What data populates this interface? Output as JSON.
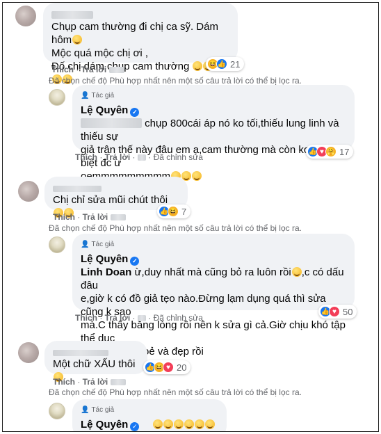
{
  "comments": [
    {
      "text_lines": [
        "Chụp cam thường đi chị ca sỹ. Dám hôm",
        "Mộc quá mộc chị ơi ,",
        "Đố chị dám chụp cam thường"
      ],
      "actions": {
        "like": "Thích",
        "reply": "Trả lời"
      },
      "reaction_count": "21"
    },
    {
      "badge": "Tác giả",
      "author": "Lệ Quyên",
      "text_lines": [
        "chụp 800cái áp nó ko tối,thiếu lung linh và thiếu sự",
        "giả trân thế này đâu em ạ,cam thường mà còn ko phân biệt đc ư",
        "oemmmmmmmmm"
      ],
      "actions": {
        "like": "Thích",
        "reply": "Trả lời",
        "edited": "Đã chỉnh sửa"
      },
      "reaction_count": "17"
    },
    {
      "text_lines": [
        "Chị chỉ sửa mũi chút thôi"
      ],
      "actions": {
        "like": "Thích",
        "reply": "Trả lời"
      },
      "reaction_count": "7"
    },
    {
      "badge": "Tác giả",
      "author": "Lệ Quyên",
      "mention": "Linh Doan",
      "text_lines": [
        "ừ,duy nhất mà cũng bỏ ra luôn rồi",
        ",c có dấu đâu",
        "e,giờ k có đồ giả tẹo nào.Đừng lạm dụng quá thì sửa cũng k sao",
        "mà.C thấy bằng lòng rồi nên k sửa gì cả.Giờ chịu khó tập thể dục",
        "thôi.Thế là khoẻ và đẹp rồi"
      ],
      "actions": {
        "like": "Thích",
        "reply": "Trả lời",
        "edited": "Đã chỉnh sửa"
      },
      "reaction_count": "50"
    },
    {
      "text_lines": [
        "Một chữ XẤU thôi"
      ],
      "actions": {
        "like": "Thích",
        "reply": "Trả lời"
      },
      "reaction_count": "20"
    },
    {
      "badge": "Tác giả",
      "author": "Lệ Quyên"
    }
  ],
  "filter_note": "Đã chọn chế độ Phù hợp nhất nên một số câu trả lời có thể bị lọc ra.",
  "icons": {
    "like": "like-icon",
    "haha": "haha-icon",
    "love": "love-icon",
    "care": "care-icon",
    "verified": "verified-badge-icon",
    "author_badge": "author-badge-icon",
    "globe": "globe-icon"
  },
  "colors": {
    "bubble": "#f0f2f5",
    "meta": "#65676b",
    "like_blue": "#1877f2",
    "love_red": "#f33e58",
    "haha_yellow": "#f7b125"
  }
}
